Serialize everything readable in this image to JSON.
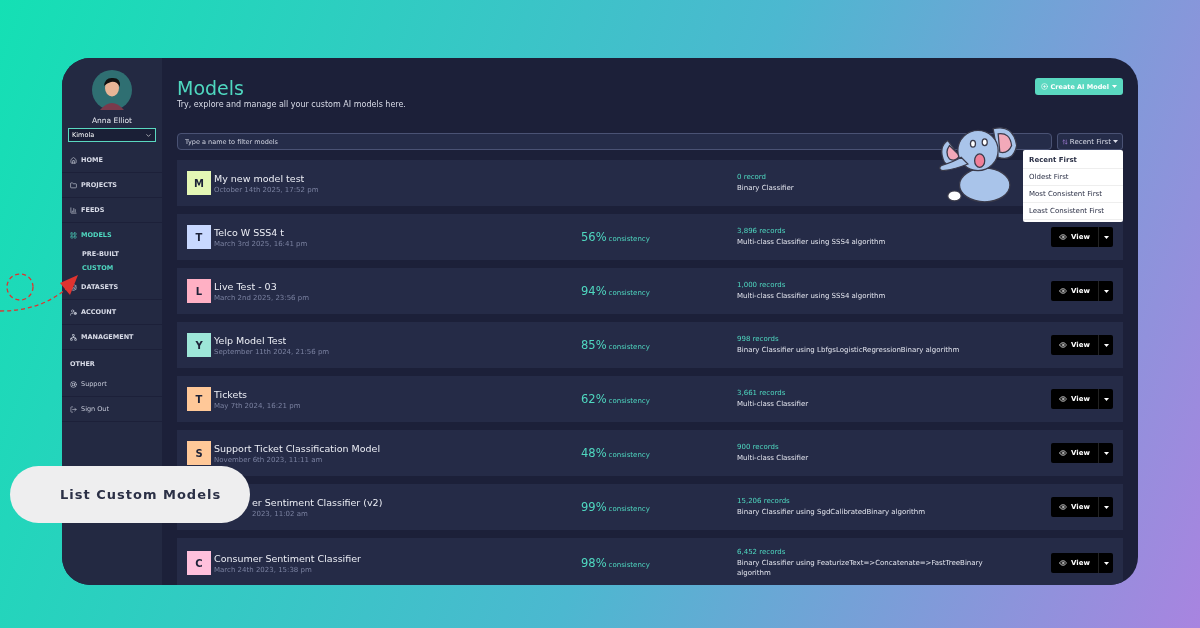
{
  "sidebar": {
    "user_name": "Anna Elliot",
    "workspace": "Kimola",
    "items": [
      {
        "label": "HOME",
        "selected": false,
        "kind": "main"
      },
      {
        "label": "PROJECTS",
        "selected": false,
        "kind": "main"
      },
      {
        "label": "FEEDS",
        "selected": false,
        "kind": "main"
      },
      {
        "label": "MODELS",
        "selected": true,
        "kind": "parent"
      },
      {
        "label": "PRE-BUILT",
        "selected": false,
        "kind": "sub"
      },
      {
        "label": "CUSTOM",
        "selected": true,
        "kind": "sub"
      },
      {
        "label": "DATASETS",
        "selected": false,
        "kind": "main"
      },
      {
        "label": "ACCOUNT",
        "selected": false,
        "kind": "main"
      },
      {
        "label": "MANAGEMENT",
        "selected": false,
        "kind": "main"
      },
      {
        "label": "OTHER",
        "kind": "header"
      },
      {
        "label": "Support",
        "selected": false,
        "kind": "minor"
      },
      {
        "label": "Sign Out",
        "selected": false,
        "kind": "minor"
      }
    ]
  },
  "header": {
    "title": "Models",
    "subtitle": "Try, explore and manage all your custom AI models here.",
    "create_button": "Create AI Model"
  },
  "search": {
    "placeholder": "Type a name to filter models"
  },
  "sort": {
    "label": "Recent First",
    "options": [
      {
        "label": "Recent First",
        "selected": true
      },
      {
        "label": "Oldest First",
        "selected": false
      },
      {
        "label": "Most Consistent First",
        "selected": false
      },
      {
        "label": "Least Consistent First",
        "selected": false
      }
    ]
  },
  "models": [
    {
      "letter": "M",
      "color": "#e4f7b5",
      "name": "My new model test",
      "date": "October 14th 2025, 17:52 pm",
      "records": "0 record",
      "description": "Binary Classifier"
    },
    {
      "letter": "T",
      "color": "#c8d8ff",
      "name": "Telco W SSS4 t",
      "date": "March 3rd 2025, 16:41 pm",
      "percent": "56%",
      "consistency": "consistency",
      "records": "3,896 records",
      "description": "Multi-class Classifier using SSS4 algorithm",
      "view": "View"
    },
    {
      "letter": "L",
      "color": "#ffb0c4",
      "name": "Live Test - 03",
      "date": "March 2nd 2025, 23:56 pm",
      "percent": "94%",
      "consistency": "consistency",
      "records": "1,000 records",
      "description": "Multi-class Classifier using SSS4 algorithm",
      "view": "View"
    },
    {
      "letter": "Y",
      "color": "#9de6d8",
      "name": "Yelp Model Test",
      "date": "September 11th 2024, 21:56 pm",
      "percent": "85%",
      "consistency": "consistency",
      "records": "998 records",
      "description": "Binary Classifier using LbfgsLogisticRegressionBinary algorithm",
      "view": "View"
    },
    {
      "letter": "T",
      "color": "#ffc898",
      "name": "Tickets",
      "date": "May 7th 2024, 16:21 pm",
      "percent": "62%",
      "consistency": "consistency",
      "records": "3,661 records",
      "description": "Multi-class Classifier",
      "view": "View"
    },
    {
      "letter": "S",
      "color": "#ffc898",
      "name": "Support Ticket Classification Model",
      "date": "November 6th 2023, 11:11 am",
      "percent": "48%",
      "consistency": "consistency",
      "records": "900 records",
      "description": "Multi-class Classifier",
      "view": "View"
    },
    {
      "name": "er Sentiment Classifier (v2)",
      "date": "2023, 11:02 am",
      "percent": "99%",
      "consistency": "consistency",
      "records": "15,206 records",
      "description": "Binary Classifier using SgdCalibratedBinary algorithm",
      "view": "View"
    },
    {
      "letter": "C",
      "color": "#ffc0dc",
      "name": "Consumer Sentiment Classifier",
      "date": "March 24th 2023, 15:38 pm",
      "percent": "98%",
      "consistency": "consistency",
      "records": "6,452 records",
      "description": "Binary Classifier using FeaturizeText=>Concatenate=>FastTreeBinary algorithm",
      "view": "View"
    }
  ],
  "callout": {
    "text": "List Custom Models"
  }
}
